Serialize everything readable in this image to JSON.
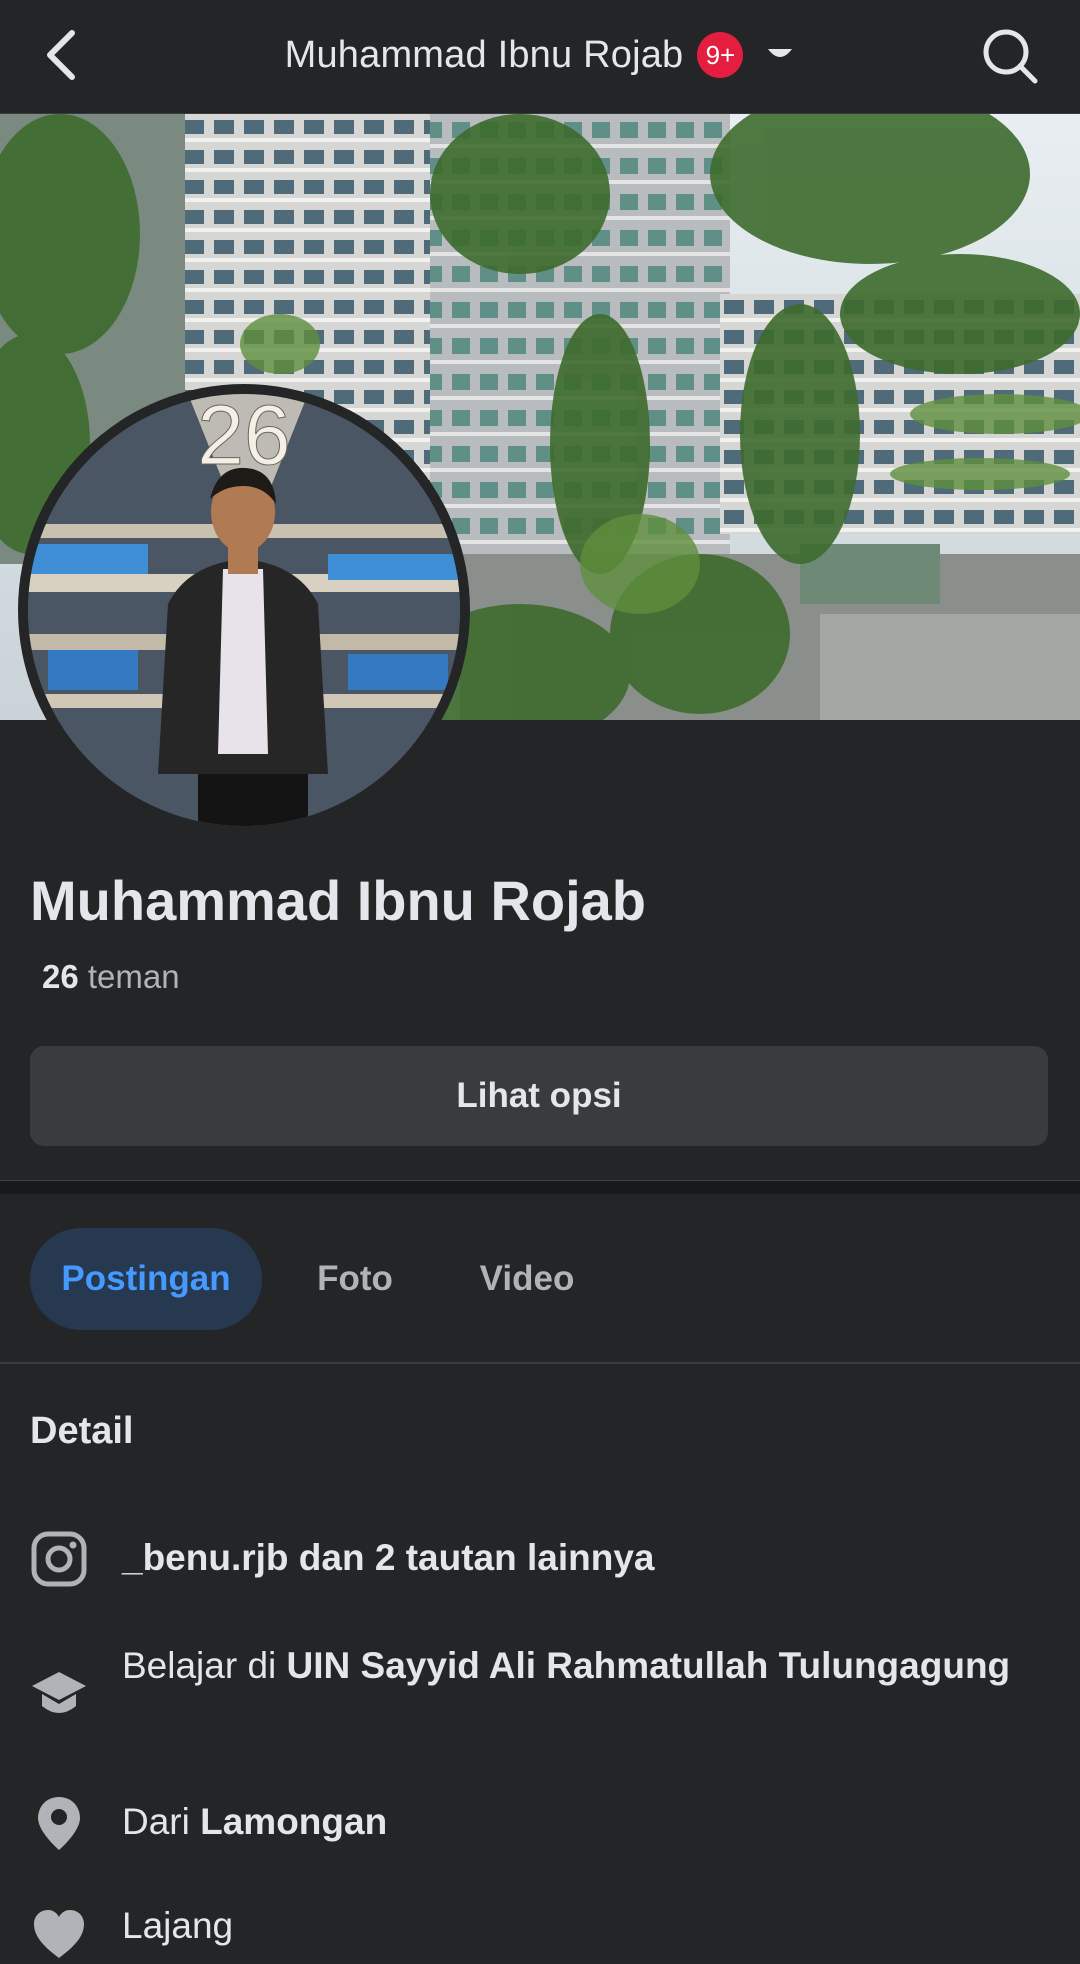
{
  "topbar": {
    "title": "Muhammad Ibnu Rojab",
    "badge": "9+"
  },
  "profile": {
    "name": "Muhammad Ibnu Rojab",
    "friends_count": "26",
    "friends_label": "teman",
    "options_label": "Lihat opsi",
    "avatar_sign": "26"
  },
  "tabs": [
    {
      "label": "Postingan",
      "active": true
    },
    {
      "label": "Foto",
      "active": false
    },
    {
      "label": "Video",
      "active": false
    }
  ],
  "details": {
    "title": "Detail",
    "links": "_benu.rjb dan 2 tautan lainnya",
    "education_prefix": "Belajar di",
    "education_school": "UIN Sayyid Ali Rahmatullah Tulungagung",
    "hometown_prefix": "Dari",
    "hometown_place": "Lamongan",
    "relationship_partial": "Lajang"
  },
  "colors": {
    "background": "#242526",
    "button": "#3a3b3c",
    "accent_blue": "#4599ff",
    "active_tab_bg": "#263951",
    "badge_red": "#e41e3f",
    "text_primary": "#e4e6eb",
    "text_secondary": "#b0b3b8"
  },
  "icons": {
    "back": "back-arrow-icon",
    "search": "search-icon",
    "caret": "caret-down-icon",
    "instagram": "instagram-icon",
    "education": "graduation-cap-icon",
    "location": "location-pin-icon",
    "relationship": "heart-icon"
  }
}
